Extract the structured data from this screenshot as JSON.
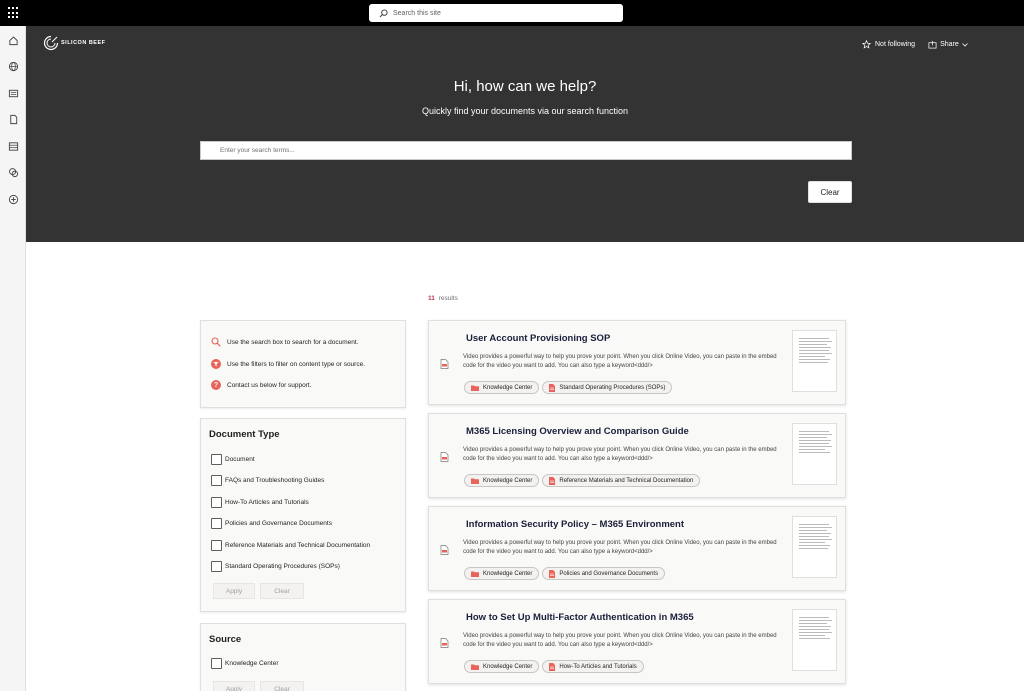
{
  "topbar": {
    "search_placeholder": "Search this site",
    "icons": [
      "app-launcher-icon",
      "search-icon"
    ]
  },
  "rail": {
    "icons": [
      "home-icon",
      "globe-icon",
      "news-icon",
      "document-icon",
      "list-icon",
      "chat-icon",
      "add-icon"
    ]
  },
  "hero": {
    "logo_text": "SILICON BEEF",
    "follow_label": "Not following",
    "share_label": "Share",
    "title": "Hi, how can we help?",
    "subtitle": "Quickly find your documents via our search function",
    "search_placeholder": "Enter your search terms...",
    "clear_label": "Clear"
  },
  "results": {
    "count": "11",
    "count_label": "results"
  },
  "help": {
    "items": [
      "Use the search box to search for a document.",
      "Use the filters to filter on content type or source.",
      "Contact us below for support."
    ]
  },
  "document_type": {
    "title": "Document Type",
    "options": [
      "Document",
      "FAQs and Troubleshooting Guides",
      "How-To Articles and Tutorials",
      "Policies and Governance Documents",
      "Reference Materials and Technical Documentation",
      "Standard Operating Procedures (SOPs)"
    ],
    "apply_label": "Apply",
    "clear_label": "Clear"
  },
  "source": {
    "title": "Source",
    "options": [
      "Knowledge Center"
    ],
    "apply_label": "Apply",
    "clear_label": "Clear"
  },
  "cards": [
    {
      "title": "User Account Provisioning SOP",
      "description": "Video provides a powerful way to help you prove your point. When you click Online Video, you can paste in the embed code for the video you want to add. You can also type a keyword<ddd/>",
      "tags": [
        "Knowledge Center",
        "Standard Operating Procedures (SOPs)"
      ]
    },
    {
      "title": "M365 Licensing Overview and Comparison Guide",
      "description": "Video provides a powerful way to help you prove your point. When you click Online Video, you can paste in the embed code for the video you want to add. You can also type a keyword<ddd/>",
      "tags": [
        "Knowledge Center",
        "Reference Materials and Technical Documentation"
      ]
    },
    {
      "title": "Information Security Policy – M365 Environment",
      "description": "Video provides a powerful way to help you prove your point. When you click Online Video, you can paste in the embed code for the video you want to add. You can also type a keyword<ddd/>",
      "tags": [
        "Knowledge Center",
        "Policies and Governance Documents"
      ]
    },
    {
      "title": "How to Set Up Multi-Factor Authentication in M365",
      "description": "Video provides a powerful way to help you prove your point. When you click Online Video, you can paste in the embed code for the video you want to add. You can also type a keyword<ddd/>",
      "tags": [
        "Knowledge Center",
        "How-To Articles and Tutorials"
      ]
    }
  ],
  "colors": {
    "hero_bg": "#333333",
    "accent_red": "#e8635a",
    "count_red": "#c4314b",
    "card_title": "#1b1f3b"
  }
}
